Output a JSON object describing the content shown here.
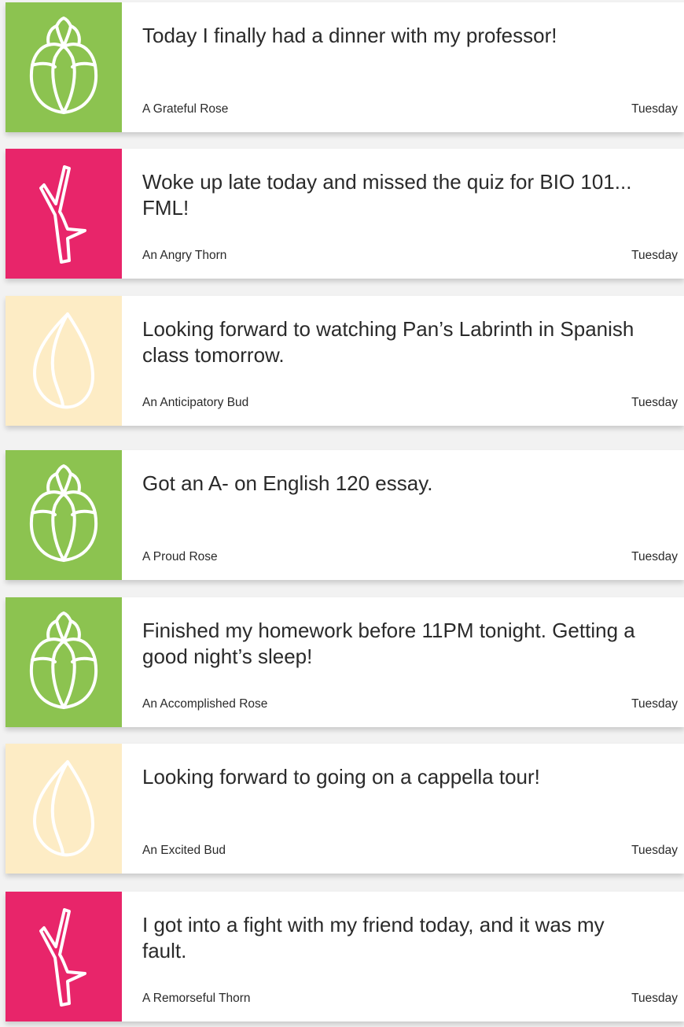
{
  "colors": {
    "rose": "#8cc350",
    "thorn": "#e8256a",
    "bud": "#fdecc5"
  },
  "posts": [
    {
      "type": "rose",
      "icon": "rose-icon",
      "message": "Today I finally had a dinner with my professor!",
      "author": "A Grateful Rose",
      "day": "Tuesday"
    },
    {
      "type": "thorn",
      "icon": "thorn-icon",
      "message": "Woke up late today and missed the quiz for BIO 101... FML!",
      "author": "An Angry Thorn",
      "day": "Tuesday"
    },
    {
      "type": "bud",
      "icon": "bud-icon",
      "message": "Looking forward to watching Pan’s Labrinth in Span­ish class tomorrow.",
      "author": "An Anticipatory Bud",
      "day": "Tuesday"
    },
    {
      "type": "rose",
      "icon": "rose-icon",
      "message": "Got an A- on English 120 essay.",
      "author": "A Proud Rose",
      "day": "Tuesday"
    },
    {
      "type": "rose",
      "icon": "rose-icon",
      "message": "Finished my homework before 11PM tonight. Get­ting a good night’s sleep!",
      "author": "An Accomplished Rose",
      "day": "Tuesday"
    },
    {
      "type": "bud",
      "icon": "bud-icon",
      "message": "Looking forward to going on a cappella tour!",
      "author": "An Excited Bud",
      "day": "Tuesday"
    },
    {
      "type": "thorn",
      "icon": "thorn-icon",
      "message": "I got into a fight with my friend today, and it was my fault.",
      "author": "A Remorseful Thorn",
      "day": "Tuesday"
    }
  ]
}
